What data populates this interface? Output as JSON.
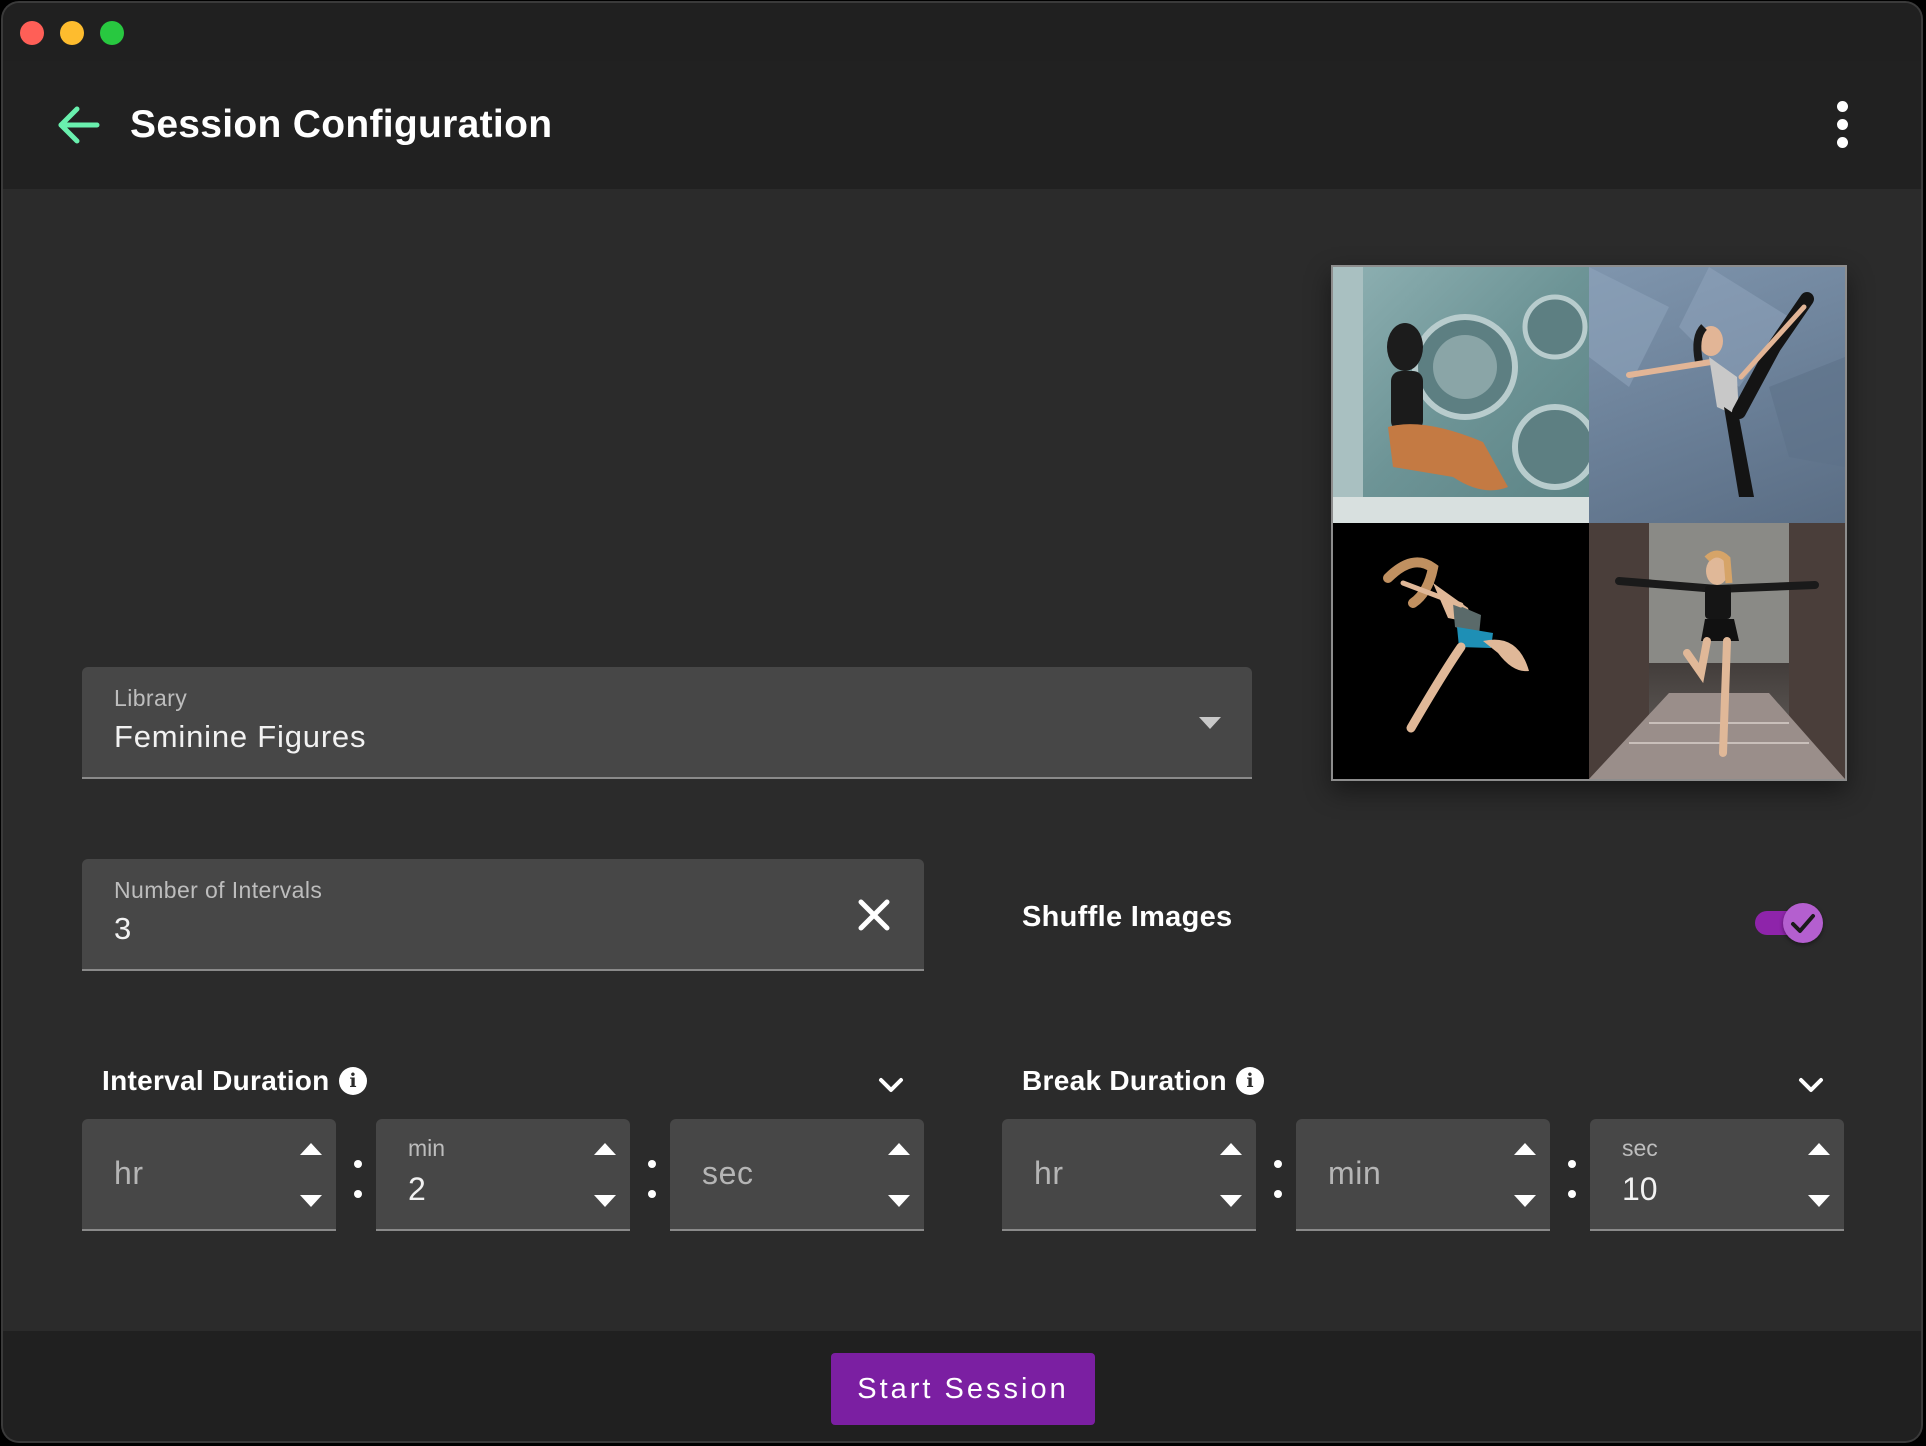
{
  "app_title": "Session Configuration",
  "library": {
    "label": "Library",
    "value": "Feminine Figures"
  },
  "intervals": {
    "label": "Number of Intervals",
    "value": "3"
  },
  "shuffle": {
    "label": "Shuffle Images",
    "enabled": true
  },
  "interval_duration": {
    "label": "Interval Duration",
    "hr": {
      "placeholder": "hr",
      "value": ""
    },
    "min": {
      "label": "min",
      "value": "2"
    },
    "sec": {
      "placeholder": "sec",
      "value": ""
    }
  },
  "break_duration": {
    "label": "Break Duration",
    "hr": {
      "placeholder": "hr",
      "value": ""
    },
    "min": {
      "placeholder": "min",
      "value": ""
    },
    "sec": {
      "label": "sec",
      "value": "10"
    }
  },
  "start_button": "Start Session",
  "colors": {
    "accent_purple": "#7b1fa2",
    "toggle_purple": "#9c27b0",
    "back_arrow": "#69f0ae",
    "background": "#2b2b2b",
    "appbar": "#212121",
    "field": "#474747"
  },
  "icons": {
    "back": "arrow-left-icon",
    "more": "more-vertical-icon",
    "library_dropdown": "caret-down-icon",
    "clear": "close-icon",
    "info": "info-icon",
    "expand": "chevron-down-icon",
    "toggle_check": "check-icon"
  },
  "preview_images": [
    {
      "name": "woman-laundromat-photo"
    },
    {
      "name": "dancer-standing-split-photo"
    },
    {
      "name": "dancer-leaping-photo"
    },
    {
      "name": "dancer-street-arabesque-photo"
    }
  ]
}
